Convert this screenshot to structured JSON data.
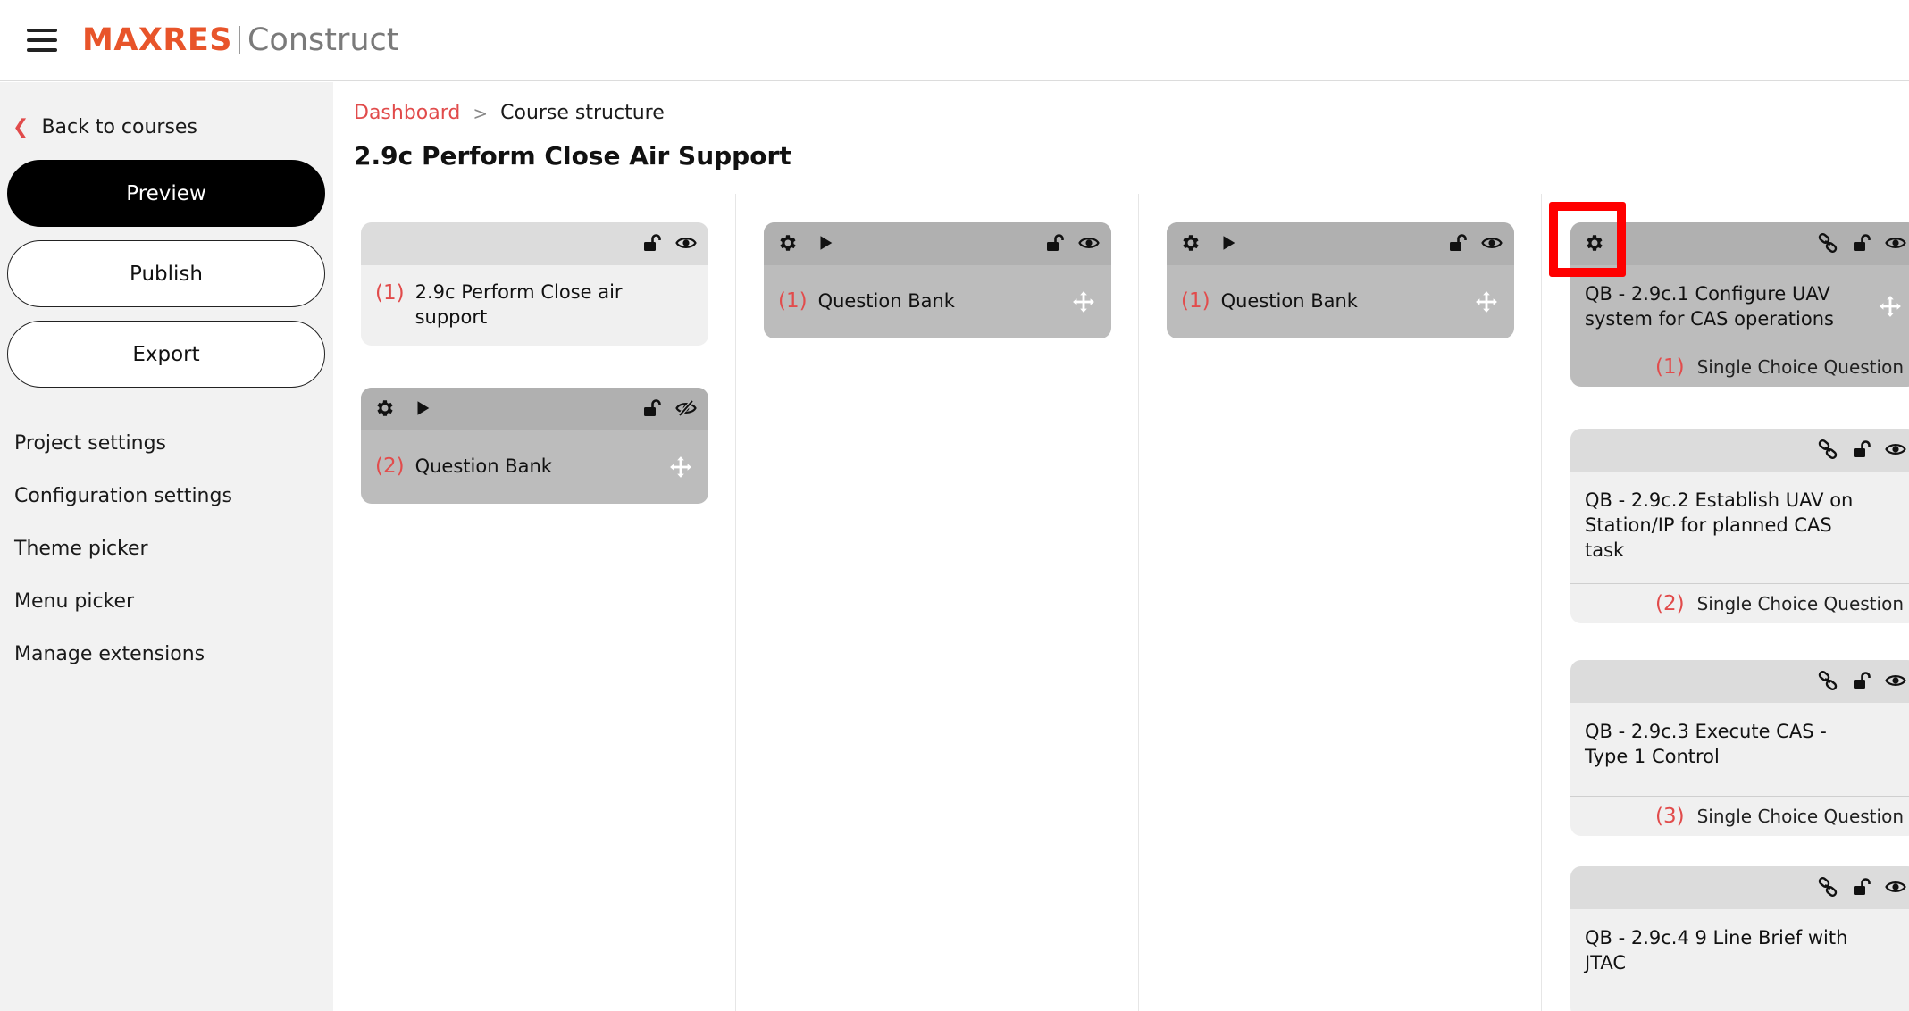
{
  "header": {
    "brand": "MAXRES",
    "product": "Construct"
  },
  "sidebar": {
    "back_label": "Back to courses",
    "buttons": {
      "preview": "Preview",
      "publish": "Publish",
      "export": "Export"
    },
    "links": [
      "Project settings",
      "Configuration settings",
      "Theme picker",
      "Menu picker",
      "Manage extensions"
    ]
  },
  "breadcrumb": {
    "dashboard": "Dashboard",
    "separator": ">",
    "current": "Course structure"
  },
  "page_title": "2.9c Perform Close Air Support",
  "columns": [
    {
      "cards": [
        {
          "number": "(1)",
          "title": "2.9c Perform Close air support"
        },
        {
          "number": "(2)",
          "title": "Question Bank"
        }
      ]
    },
    {
      "cards": [
        {
          "number": "(1)",
          "title": "Question Bank"
        }
      ]
    },
    {
      "cards": [
        {
          "number": "(1)",
          "title": "Question Bank"
        }
      ]
    },
    {
      "cards": [
        {
          "number": "(1)",
          "title": "QB - 2.9c.1 Configure UAV system for CAS operations",
          "type": "Single Choice Question"
        },
        {
          "number": "(2)",
          "title": "QB - 2.9c.2 Establish UAV on Station/IP for planned CAS task",
          "type": "Single Choice Question"
        },
        {
          "number": "(3)",
          "title": "QB - 2.9c.3 Execute CAS - Type 1 Control",
          "type": "Single Choice Question"
        },
        {
          "number": "",
          "title": "QB - 2.9c.4 9 Line Brief with JTAC",
          "type": ""
        }
      ]
    }
  ],
  "colors": {
    "accent": "#e14b4b",
    "brand": "#e8542a",
    "highlight": "#ff0000"
  }
}
